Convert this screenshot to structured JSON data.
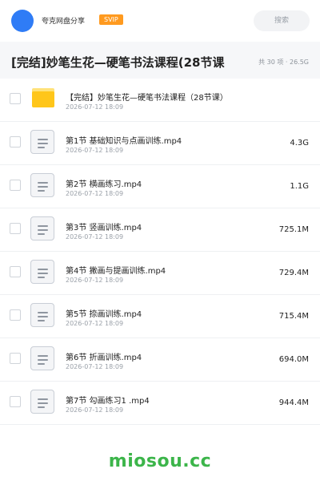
{
  "header": {
    "share_name": "夸克网盘分享",
    "badge": "SVIP",
    "search_placeholder": "搜索"
  },
  "title": {
    "text": "[完结]妙笔生花—硬笔书法课程(28节课",
    "meta": "共 30 项 · 26.5G"
  },
  "items": [
    {
      "type": "folder",
      "name": "【完结】妙笔生花—硬笔书法课程（28节课）",
      "date": "2026-07-12 18:09",
      "size": ""
    },
    {
      "type": "file",
      "name": "第1节 基础知识与点画训练.mp4",
      "date": "2026-07-12 18:09",
      "size": "4.3G"
    },
    {
      "type": "file",
      "name": "第2节 横画练习.mp4",
      "date": "2026-07-12 18:09",
      "size": "1.1G"
    },
    {
      "type": "file",
      "name": "第3节 竖画训练.mp4",
      "date": "2026-07-12 18:09",
      "size": "725.1M"
    },
    {
      "type": "file",
      "name": "第4节 撇画与提画训练.mp4",
      "date": "2026-07-12 18:09",
      "size": "729.4M"
    },
    {
      "type": "file",
      "name": "第5节 捺画训练.mp4",
      "date": "2026-07-12 18:09",
      "size": "715.4M"
    },
    {
      "type": "file",
      "name": "第6节 折画训练.mp4",
      "date": "2026-07-12 18:09",
      "size": "694.0M"
    },
    {
      "type": "file",
      "name": "第7节 勾画练习1 .mp4",
      "date": "2026-07-12 18:09",
      "size": "944.4M"
    }
  ],
  "watermark": "miosou.cc",
  "colors": {
    "accent_blue": "#2f7cf6",
    "svip_orange": "#ff9a1f",
    "folder_yellow": "#ffc61a",
    "watermark_green": "#3cb54a"
  }
}
